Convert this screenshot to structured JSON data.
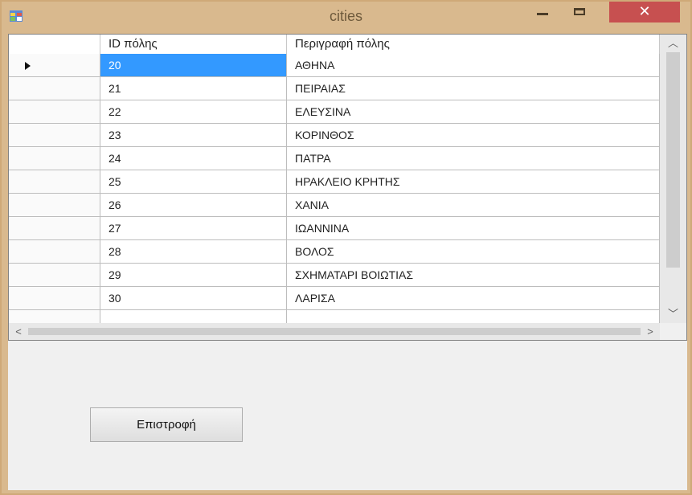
{
  "window": {
    "title": "cities",
    "close_label": "✕"
  },
  "grid": {
    "columns": [
      "ID πόλης",
      "Περιγραφή πόλης"
    ],
    "rows": [
      {
        "id": "20",
        "desc": "ΑΘΗΝΑ"
      },
      {
        "id": "21",
        "desc": "ΠΕΙΡΑΙΑΣ"
      },
      {
        "id": "22",
        "desc": "ΕΛΕΥΣΙΝΑ"
      },
      {
        "id": "23",
        "desc": "ΚΟΡΙΝΘΟΣ"
      },
      {
        "id": "24",
        "desc": "ΠΑΤΡΑ"
      },
      {
        "id": "25",
        "desc": "ΗΡΑΚΛΕΙΟ ΚΡΗΤΗΣ"
      },
      {
        "id": "26",
        "desc": "ΧΑΝΙΑ"
      },
      {
        "id": "27",
        "desc": "ΙΩΑΝΝΙΝΑ"
      },
      {
        "id": "28",
        "desc": "ΒΟΛΟΣ"
      },
      {
        "id": "29",
        "desc": "ΣΧΗΜΑΤΑΡΙ ΒΟΙΩΤΙΑΣ"
      },
      {
        "id": "30",
        "desc": "ΛΑΡΙΣΑ"
      }
    ],
    "selected_index": 0
  },
  "buttons": {
    "return_label": "Επιστροφή"
  },
  "colors": {
    "selection": "#3399ff",
    "title_bar": "#d9b98e",
    "close_button": "#c75050"
  }
}
